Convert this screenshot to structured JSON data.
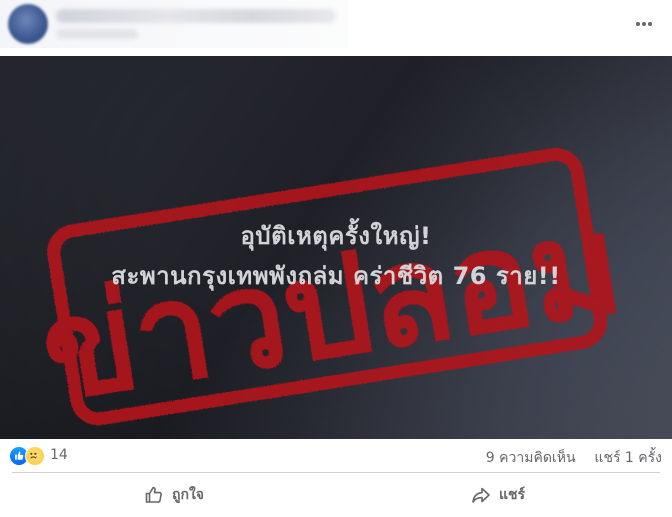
{
  "post": {
    "headline_line1": "อุบัติเหตุครั้งใหญ่!",
    "headline_line2": "สะพานกรุงเทพพังถล่ม คร่าชีวิต 76 ราย!!",
    "stamp_text": "ข่าวปลอม",
    "stamp_color": "#b0121e"
  },
  "reactions": {
    "icons": [
      "like-icon",
      "sad-icon"
    ],
    "count": "14"
  },
  "stats": {
    "comments": "9 ความคิดเห็น",
    "shares": "แชร์ 1 ครั้ง"
  },
  "actions": {
    "like_label": "ถูกใจ",
    "share_label": "แชร์"
  },
  "colors": {
    "meta_text": "#65676b",
    "like_blue": "#0866ff"
  }
}
